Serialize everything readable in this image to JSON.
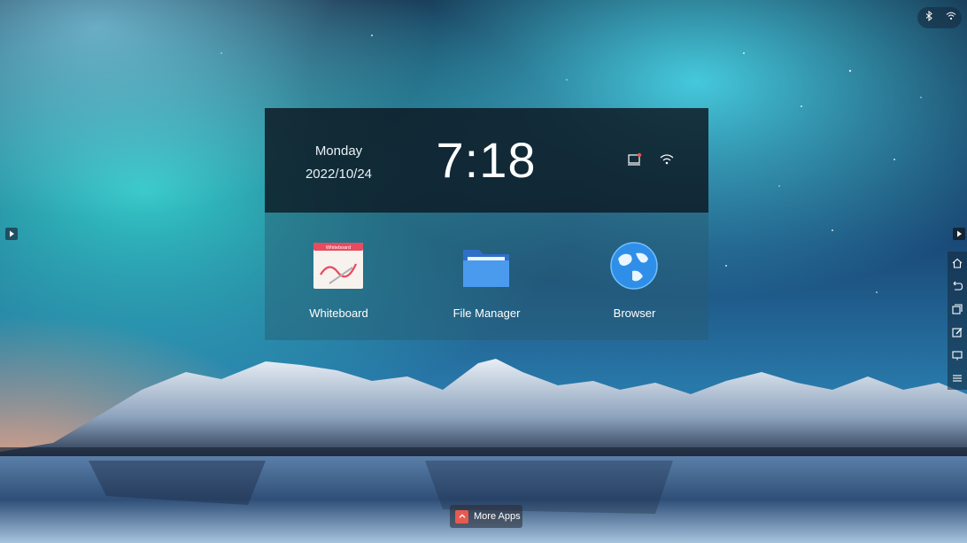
{
  "clock": {
    "day": "Monday",
    "date": "2022/10/24",
    "time": "7:18"
  },
  "apps": [
    {
      "label": "Whiteboard",
      "icon": "whiteboard-icon",
      "badge_text": "Whiteboard"
    },
    {
      "label": "File Manager",
      "icon": "folder-icon"
    },
    {
      "label": "Browser",
      "icon": "globe-icon"
    }
  ],
  "dock": {
    "more_apps_label": "More Apps"
  },
  "status_icons": [
    "bluetooth-icon",
    "wifi-icon"
  ],
  "side_toolbar": [
    "home-icon",
    "back-icon",
    "multitask-icon",
    "annotate-icon",
    "screen-share-icon",
    "menu-icon"
  ],
  "colors": {
    "accent": "#e85a4f",
    "panel_dark": "#0c1620",
    "folder_blue": "#3b8fe0",
    "globe_blue": "#2f8fe8"
  }
}
